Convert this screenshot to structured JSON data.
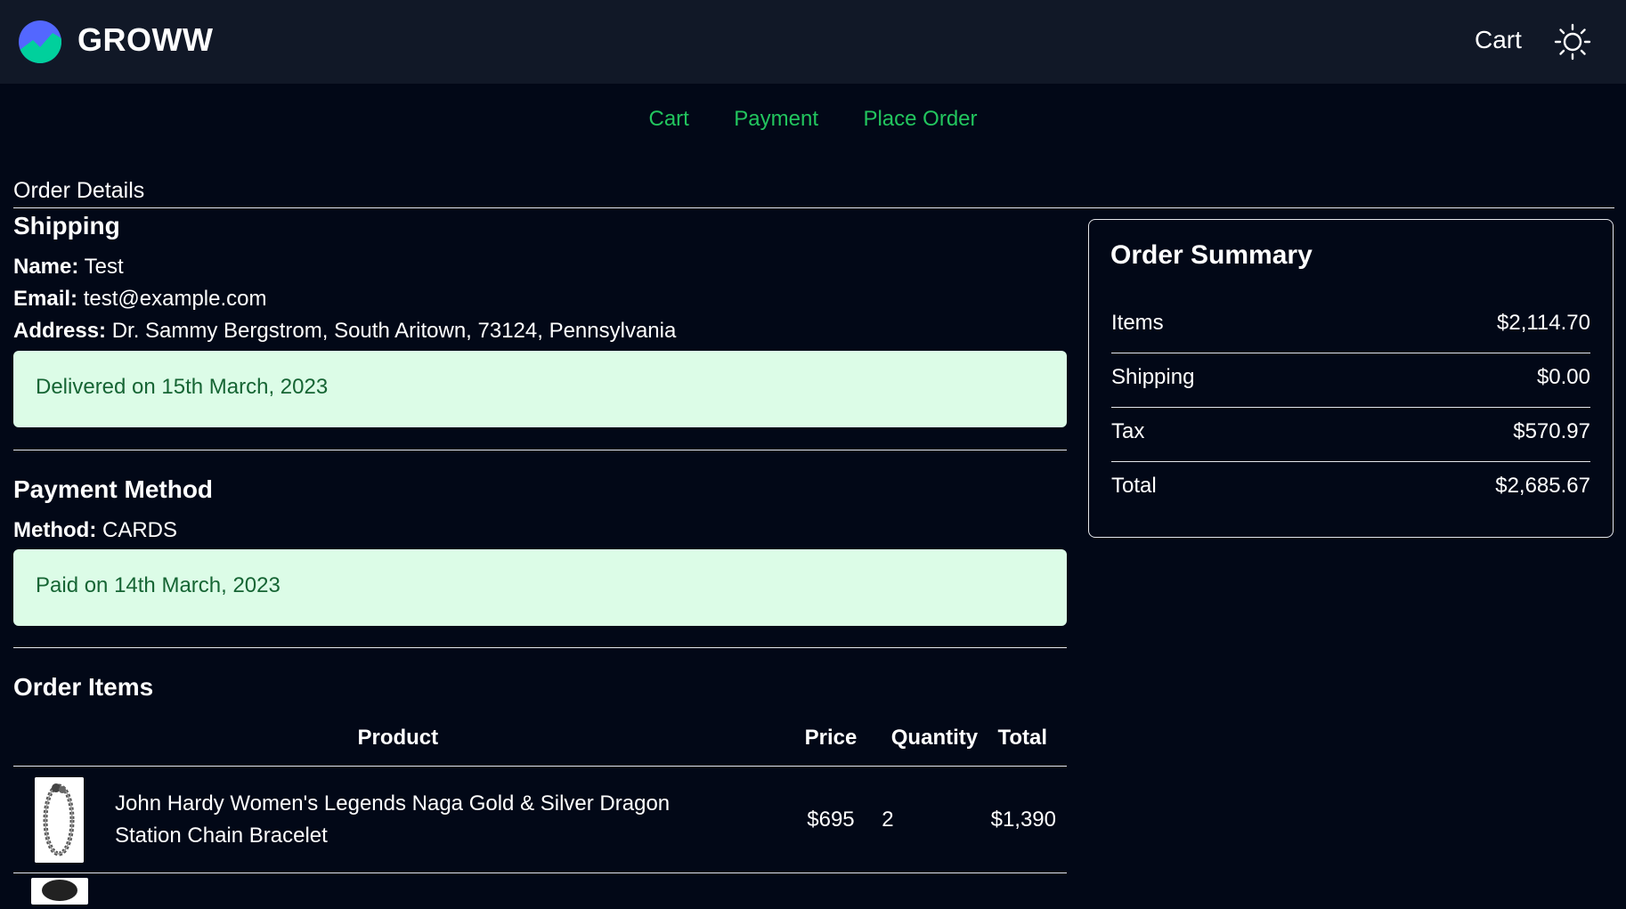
{
  "header": {
    "brand": "GROWW",
    "cart_link": "Cart",
    "logo_icon": "groww-logo-icon",
    "theme_icon": "sun-icon",
    "colors": {
      "background": "#111827",
      "logo_blue": "#5367ff",
      "logo_green": "#00d09c"
    }
  },
  "steps": [
    "Cart",
    "Payment",
    "Place Order"
  ],
  "page_title": "Order Details",
  "shipping": {
    "title": "Shipping",
    "name_label": "Name:",
    "name_value": "Test",
    "email_label": "Email:",
    "email_value": "test@example.com",
    "address_label": "Address:",
    "address_value": "Dr. Sammy Bergstrom, South Aritown, 73124, Pennsylvania",
    "status": "Delivered on 15th March, 2023"
  },
  "payment": {
    "title": "Payment Method",
    "method_label": "Method:",
    "method_value": "CARDS",
    "status": "Paid on 14th March, 2023"
  },
  "order_items": {
    "title": "Order Items",
    "columns": [
      "Product",
      "Price",
      "Quantity",
      "Total"
    ],
    "rows": [
      {
        "image_icon": "bracelet-image",
        "product": "John Hardy Women's Legends Naga Gold & Silver Dragon Station Chain Bracelet",
        "price": "$695",
        "quantity": "2",
        "total": "$1,390"
      }
    ]
  },
  "summary": {
    "title": "Order Summary",
    "rows": [
      {
        "label": "Items",
        "value": "$2,114.70"
      },
      {
        "label": "Shipping",
        "value": "$0.00"
      },
      {
        "label": "Tax",
        "value": "$570.97"
      },
      {
        "label": "Total",
        "value": "$2,685.67"
      }
    ]
  },
  "colors": {
    "page_background": "#020817",
    "accent_green": "#22c55e",
    "notice_background": "#dcfce7",
    "notice_text": "#166534"
  }
}
